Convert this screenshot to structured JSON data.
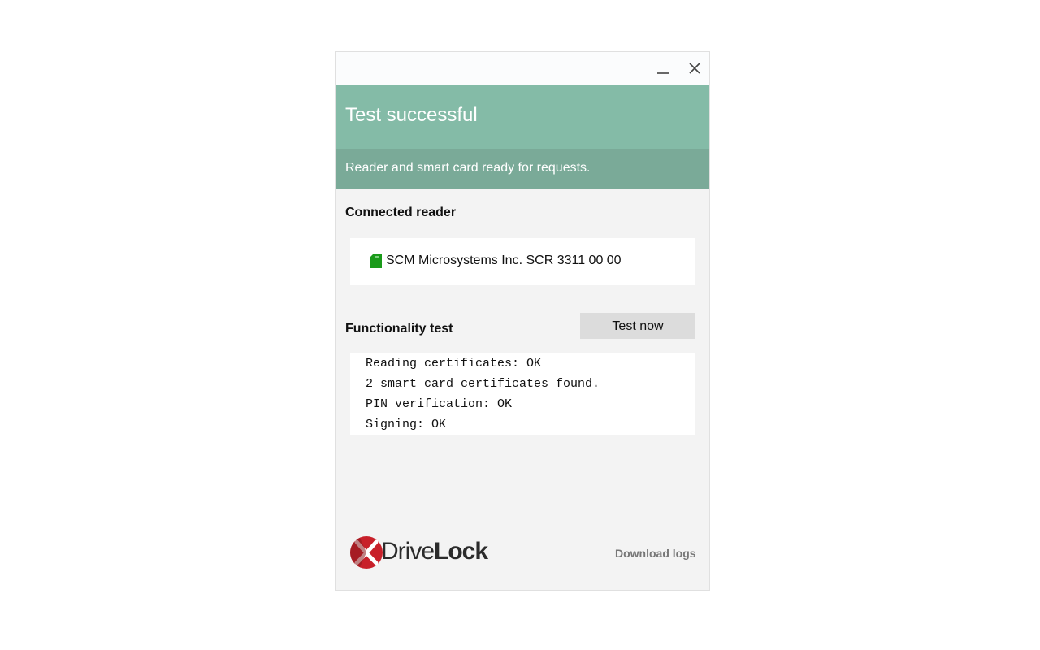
{
  "window": {
    "minimize_icon": "minimize-icon",
    "close_icon": "close-icon"
  },
  "banner": {
    "title": "Test successful",
    "subtitle": "Reader and smart card ready for requests.",
    "title_bg": "#84bba7",
    "subtitle_bg": "#7aaa98"
  },
  "reader_section": {
    "heading": "Connected reader",
    "reader_icon": "smart-card-icon",
    "reader_icon_color": "#1a9a1a",
    "reader_name": "SCM Microsystems Inc. SCR 3311 00 00"
  },
  "functionality_section": {
    "heading": "Functionality test",
    "test_button_label": "Test now",
    "output_lines": [
      "Reading certificates: OK",
      "2 smart card certificates found.",
      "PIN verification: OK",
      "Signing: OK"
    ]
  },
  "footer": {
    "logo_light": "Drive",
    "logo_bold": "Lock",
    "logo_icon": "drivelock-x-logo-icon",
    "download_logs_label": "Download logs"
  }
}
